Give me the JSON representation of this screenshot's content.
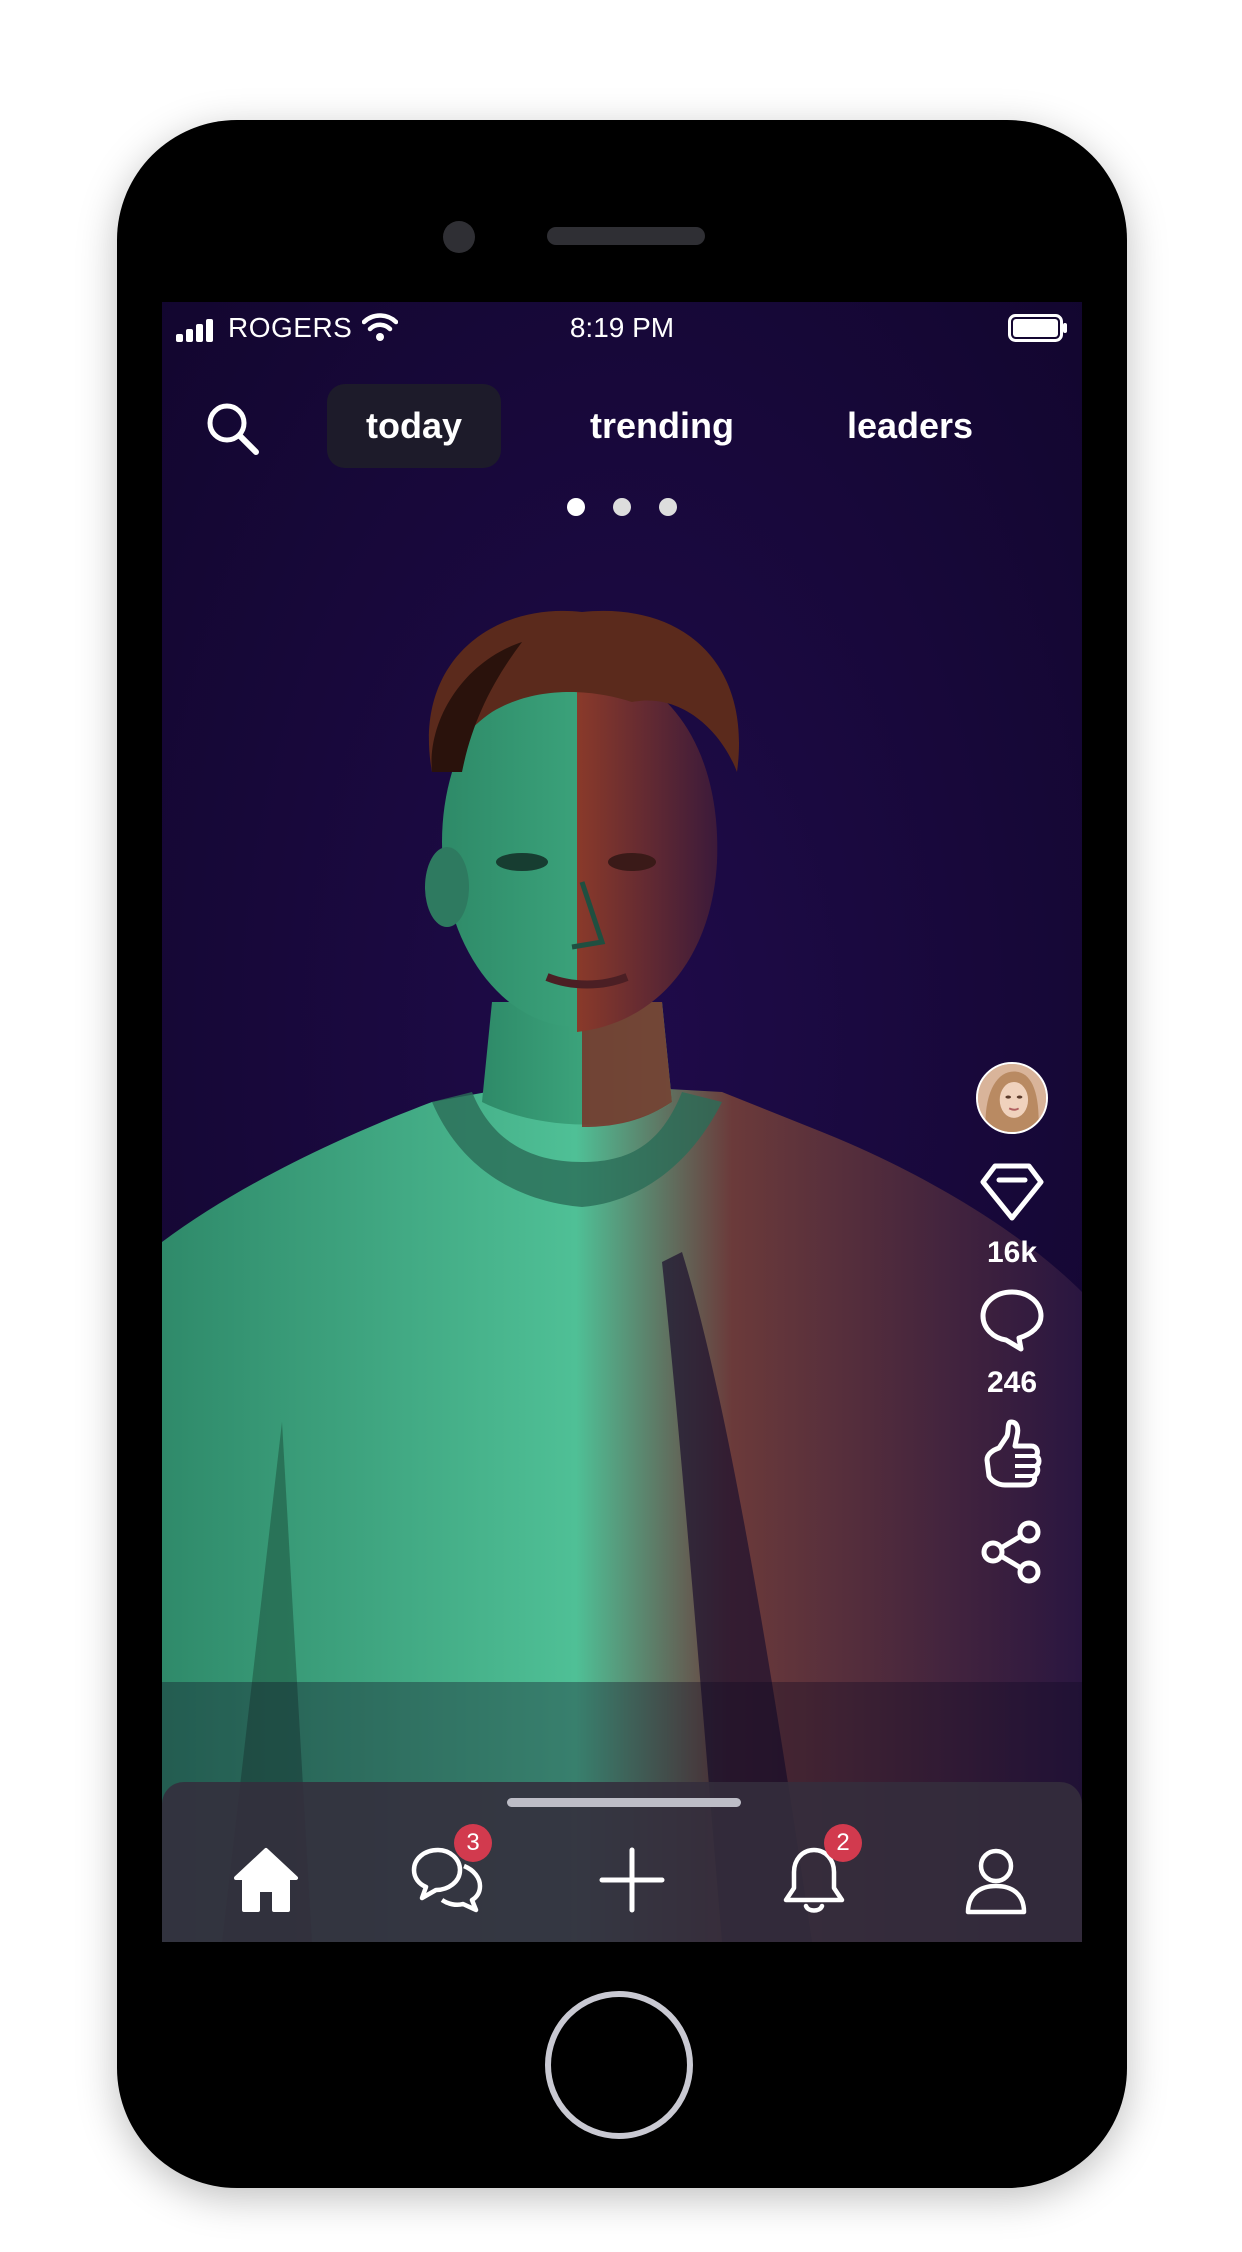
{
  "status_bar": {
    "carrier": "ROGERS",
    "time": "8:19 PM"
  },
  "top_nav": {
    "tabs": [
      {
        "label": "today",
        "active": true
      },
      {
        "label": "trending",
        "active": false
      },
      {
        "label": "leaders",
        "active": false
      }
    ],
    "search_icon": "search-icon"
  },
  "pager": {
    "count": 3,
    "active_index": 0
  },
  "action_rail": {
    "creator_avatar": "avatar",
    "gems": {
      "icon": "diamond-icon",
      "count": "16k"
    },
    "comments": {
      "icon": "comment-icon",
      "count": "246"
    },
    "like": {
      "icon": "thumbs-up-icon"
    },
    "share": {
      "icon": "share-icon"
    }
  },
  "tab_bar": {
    "items": [
      {
        "icon": "home-icon",
        "active": true
      },
      {
        "icon": "chat-icon",
        "badge": "3"
      },
      {
        "icon": "plus-icon"
      },
      {
        "icon": "bell-icon",
        "badge": "2"
      },
      {
        "icon": "profile-icon"
      }
    ]
  },
  "colors": {
    "background": "#17073a",
    "badge": "#d23a4e",
    "active_tab_bg": "#1e1e28",
    "tabbar_bg": "#342e3c"
  }
}
